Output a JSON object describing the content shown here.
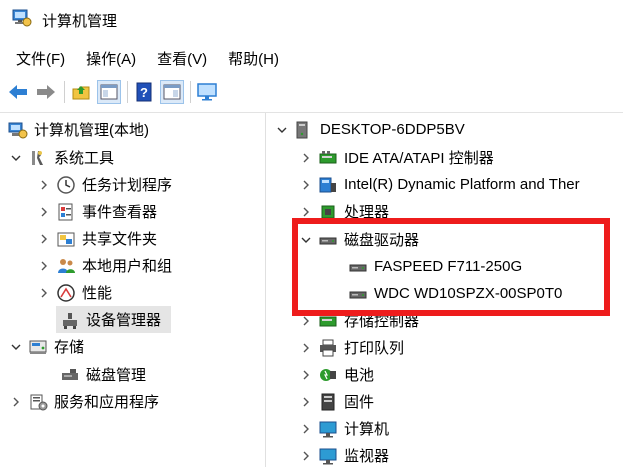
{
  "window": {
    "title": "计算机管理"
  },
  "menu": [
    "文件(F)",
    "操作(A)",
    "查看(V)",
    "帮助(H)"
  ],
  "left_tree": {
    "root": "计算机管理(本地)",
    "system_tools": "系统工具",
    "task_scheduler": "任务计划程序",
    "event_viewer": "事件查看器",
    "shared_folders": "共享文件夹",
    "local_users": "本地用户和组",
    "performance": "性能",
    "device_manager": "设备管理器",
    "storage": "存储",
    "disk_management": "磁盘管理",
    "services": "服务和应用程序"
  },
  "right_tree": {
    "computer": "DESKTOP-6DDP5BV",
    "ide": "IDE ATA/ATAPI 控制器",
    "intel": "Intel(R) Dynamic Platform and Ther",
    "processor": "处理器",
    "disk_drives": "磁盘驱动器",
    "disk1": "FASPEED F711-250G",
    "disk2": "WDC WD10SPZX-00SP0T0",
    "storage_ctrl": "存储控制器",
    "print_queue": "打印队列",
    "battery": "电池",
    "firmware": "固件",
    "computer_node": "计算机",
    "monitors": "监视器"
  },
  "colors": {
    "highlight": "#ee1c1c",
    "selected": "#e5e5e5",
    "accent": "#2b79d0"
  }
}
